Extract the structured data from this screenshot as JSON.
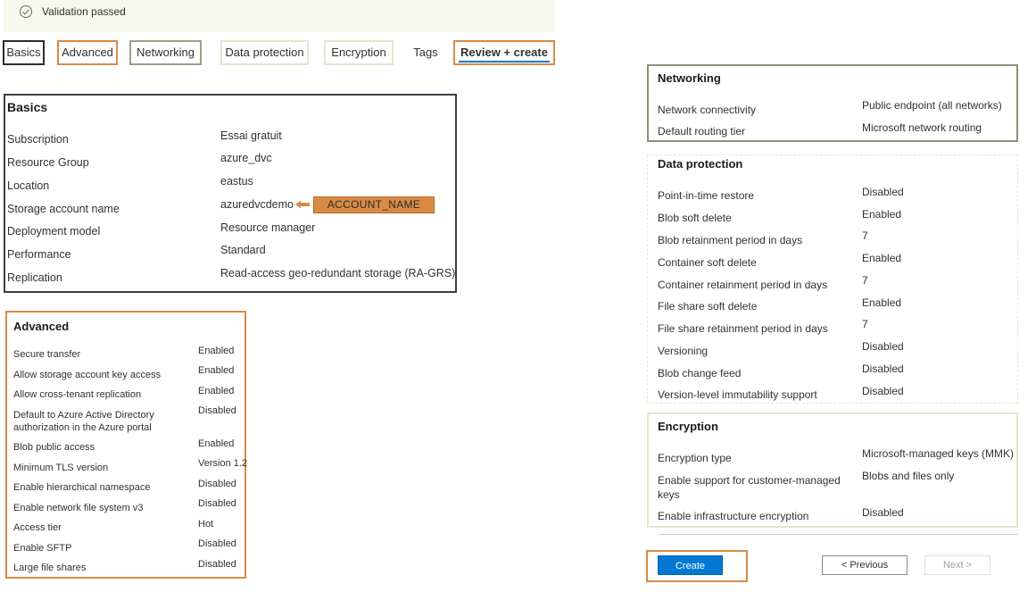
{
  "banner": {
    "text": "Validation passed",
    "icon": "check-circle-icon"
  },
  "tabs": [
    {
      "label": "Basics"
    },
    {
      "label": "Advanced"
    },
    {
      "label": "Networking"
    },
    {
      "label": "Data protection"
    },
    {
      "label": "Encryption"
    },
    {
      "label": "Tags"
    },
    {
      "label": "Review + create",
      "selected": true
    }
  ],
  "basics": {
    "title": "Basics",
    "rows": [
      {
        "label": "Subscription",
        "value": "Essai gratuit"
      },
      {
        "label": "Resource Group",
        "value": "azure_dvc"
      },
      {
        "label": "Location",
        "value": "eastus"
      },
      {
        "label": "Storage account name",
        "value": "azuredvcdemo"
      },
      {
        "label": "Deployment model",
        "value": "Resource manager"
      },
      {
        "label": "Performance",
        "value": "Standard"
      },
      {
        "label": "Replication",
        "value": "Read-access geo-redundant storage (RA-GRS)"
      }
    ],
    "annotation": "ACCOUNT_NAME"
  },
  "advanced": {
    "title": "Advanced",
    "rows": [
      {
        "label": "Secure transfer",
        "value": "Enabled"
      },
      {
        "label": "Allow storage account key access",
        "value": "Enabled"
      },
      {
        "label": "Allow cross-tenant replication",
        "value": "Enabled"
      },
      {
        "label": "Default to Azure Active Directory authorization in the Azure portal",
        "value": "Disabled"
      },
      {
        "label": "Blob public access",
        "value": "Enabled"
      },
      {
        "label": "Minimum TLS version",
        "value": "Version 1.2"
      },
      {
        "label": "Enable hierarchical namespace",
        "value": "Disabled"
      },
      {
        "label": "Enable network file system v3",
        "value": "Disabled"
      },
      {
        "label": "Access tier",
        "value": "Hot"
      },
      {
        "label": "Enable SFTP",
        "value": "Disabled"
      },
      {
        "label": "Large file shares",
        "value": "Disabled"
      }
    ]
  },
  "networking": {
    "title": "Networking",
    "rows": [
      {
        "label": "Network connectivity",
        "value": "Public endpoint (all networks)"
      },
      {
        "label": "Default routing tier",
        "value": "Microsoft network routing"
      }
    ]
  },
  "data_protection": {
    "title": "Data protection",
    "rows": [
      {
        "label": "Point-in-time restore",
        "value": "Disabled"
      },
      {
        "label": "Blob soft delete",
        "value": "Enabled"
      },
      {
        "label": "Blob retainment period in days",
        "value": "7"
      },
      {
        "label": "Container soft delete",
        "value": "Enabled"
      },
      {
        "label": "Container retainment period in days",
        "value": "7"
      },
      {
        "label": "File share soft delete",
        "value": "Enabled"
      },
      {
        "label": "File share retainment period in days",
        "value": "7"
      },
      {
        "label": "Versioning",
        "value": "Disabled"
      },
      {
        "label": "Blob change feed",
        "value": "Disabled"
      },
      {
        "label": "Version-level immutability support",
        "value": "Disabled"
      }
    ]
  },
  "encryption": {
    "title": "Encryption",
    "rows": [
      {
        "label": "Encryption type",
        "value": "Microsoft-managed keys (MMK)"
      },
      {
        "label": "Enable support for customer-managed keys",
        "value": "Blobs and files only"
      },
      {
        "label": "Enable infrastructure encryption",
        "value": "Disabled"
      }
    ]
  },
  "buttons": {
    "create": "Create",
    "previous": "< Previous",
    "next": "Next >"
  },
  "colors": {
    "accent": "#0078d4",
    "annotation": "#d98b45"
  }
}
